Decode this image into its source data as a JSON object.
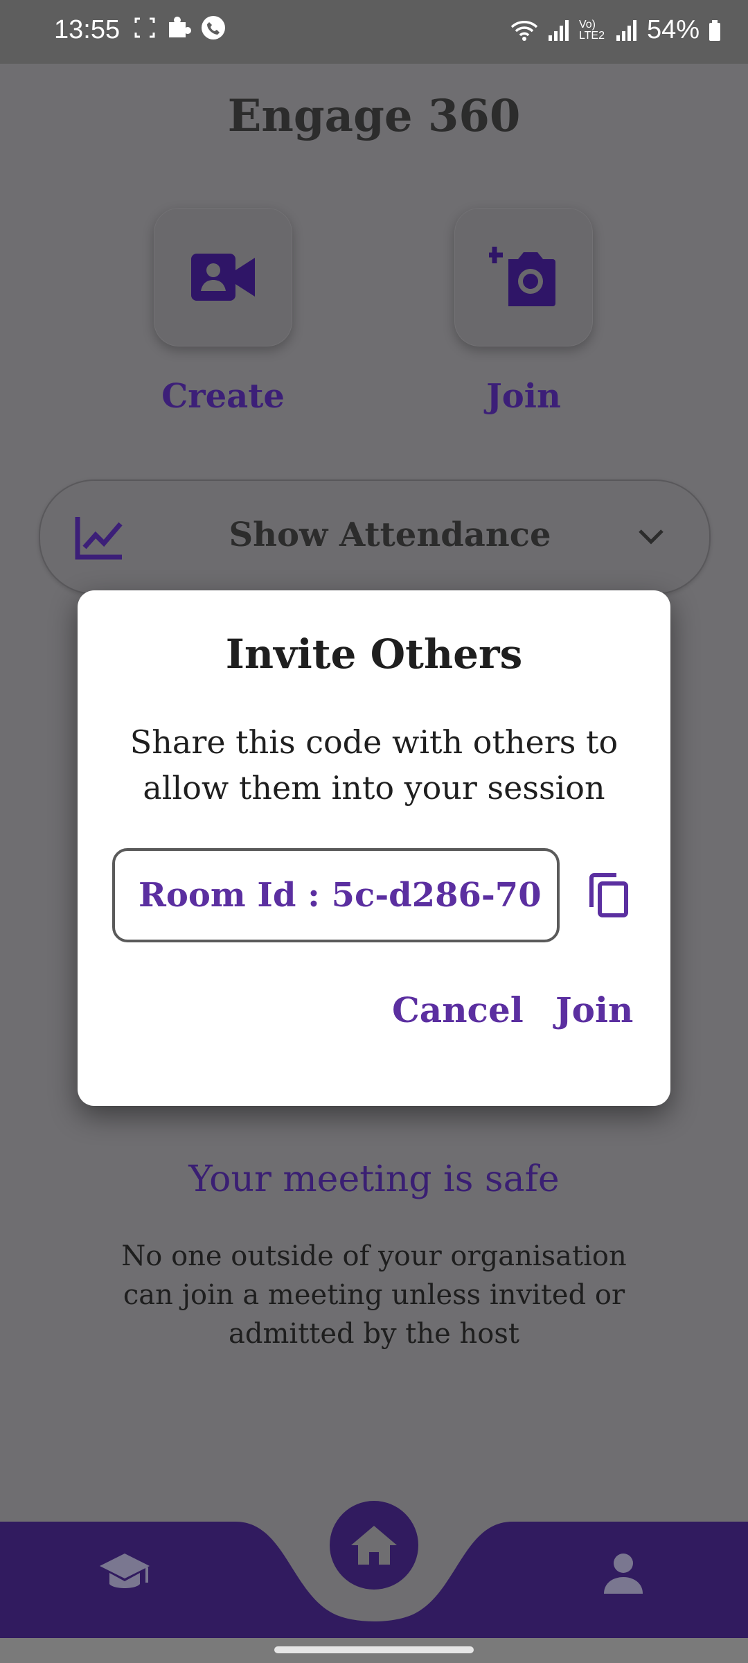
{
  "status_bar": {
    "time": "13:55",
    "battery": "54%",
    "network": "Vo) LTE2"
  },
  "app": {
    "title": "Engage 360"
  },
  "actions": {
    "create_label": "Create",
    "join_label": "Join"
  },
  "attendance": {
    "label": "Show Attendance"
  },
  "dialog": {
    "title": "Invite Others",
    "message": "Share this code with others to allow them into your session",
    "room_id": "Room Id : 5c-d286-70",
    "cancel_label": "Cancel",
    "join_label": "Join"
  },
  "safety": {
    "title": "Your meeting is safe",
    "description": "No one outside of your organisation can join a meeting unless invited or admitted by the host"
  },
  "colors": {
    "accent": "#5b2fa0",
    "nav_bar": "#311b5f",
    "scrim": "#6f6e71"
  },
  "icons": {
    "create": "video-camera-icon",
    "join": "add-camera-icon",
    "attendance": "chart-line-icon",
    "chevron": "chevron-down-icon",
    "copy": "copy-icon",
    "nav_left": "graduation-cap-icon",
    "nav_center": "home-icon",
    "nav_right": "person-icon"
  }
}
